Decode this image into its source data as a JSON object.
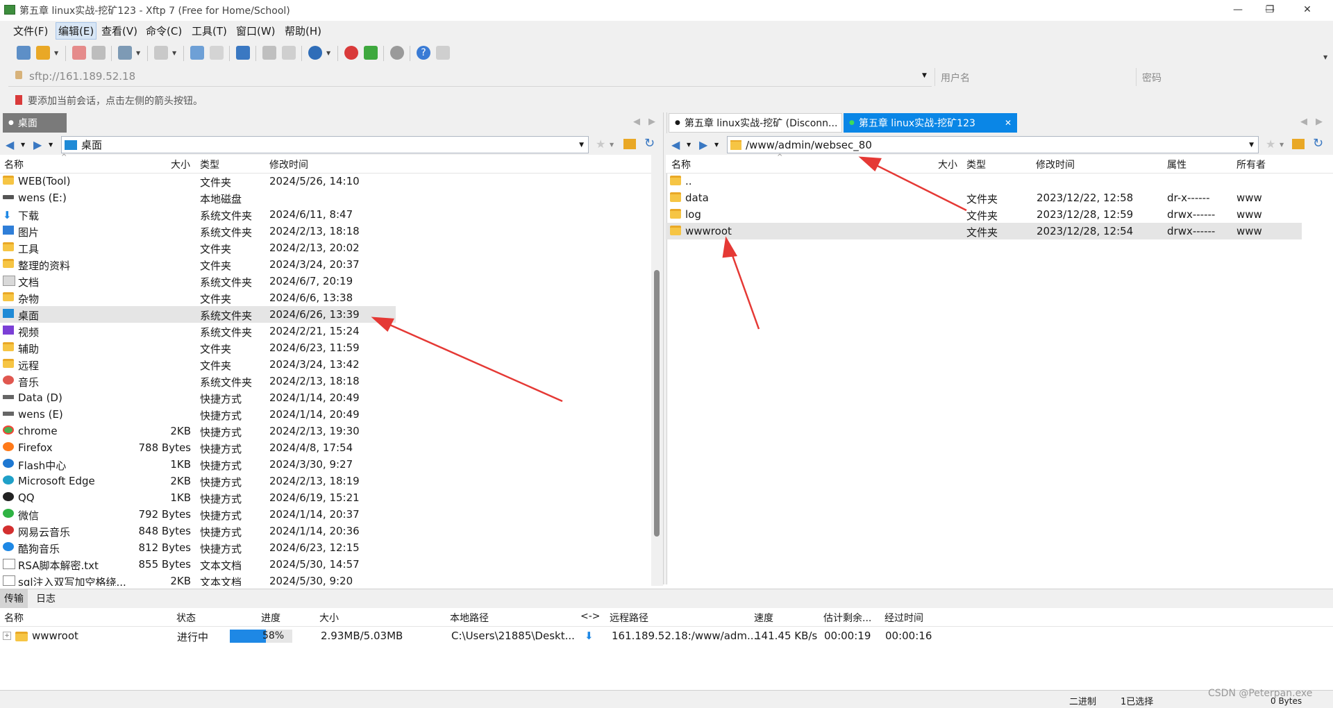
{
  "window": {
    "title": "第五章 linux实战-挖矿123 - Xftp 7 (Free for Home/School)",
    "minimize": "—",
    "maximize": "❐",
    "close": "✕"
  },
  "menu": [
    "文件(F)",
    "编辑(E)",
    "查看(V)",
    "命令(C)",
    "工具(T)",
    "窗口(W)",
    "帮助(H)"
  ],
  "address": {
    "value": "sftp://161.189.52.18",
    "user_placeholder": "用户名",
    "password_placeholder": "密码"
  },
  "hint": "要添加当前会话，点击左侧的箭头按钮。",
  "left_pane": {
    "tab": "桌面",
    "path": "桌面",
    "columns": [
      "名称",
      "大小",
      "类型",
      "修改时间"
    ],
    "rows": [
      {
        "name": "WEB(Tool)",
        "size": "",
        "type": "文件夹",
        "modified": "2024/5/26, 14:10",
        "icon": "folder-icon"
      },
      {
        "name": "wens (E:)",
        "size": "",
        "type": "本地磁盘",
        "modified": "",
        "icon": "drive-icon"
      },
      {
        "name": "下载",
        "size": "",
        "type": "系统文件夹",
        "modified": "2024/6/11, 8:47",
        "icon": "download-icon"
      },
      {
        "name": "图片",
        "size": "",
        "type": "系统文件夹",
        "modified": "2024/2/13, 18:18",
        "icon": "pictures-icon"
      },
      {
        "name": "工具",
        "size": "",
        "type": "文件夹",
        "modified": "2024/2/13, 20:02",
        "icon": "folder-icon"
      },
      {
        "name": "整理的资料",
        "size": "",
        "type": "文件夹",
        "modified": "2024/3/24, 20:37",
        "icon": "folder-icon"
      },
      {
        "name": "文档",
        "size": "",
        "type": "系统文件夹",
        "modified": "2024/6/7, 20:19",
        "icon": "documents-icon"
      },
      {
        "name": "杂物",
        "size": "",
        "type": "文件夹",
        "modified": "2024/6/6, 13:38",
        "icon": "folder-icon"
      },
      {
        "name": "桌面",
        "size": "",
        "type": "系统文件夹",
        "modified": "2024/6/26, 13:39",
        "icon": "desktop-icon",
        "selected": true
      },
      {
        "name": "视频",
        "size": "",
        "type": "系统文件夹",
        "modified": "2024/2/21, 15:24",
        "icon": "videos-icon"
      },
      {
        "name": "辅助",
        "size": "",
        "type": "文件夹",
        "modified": "2024/6/23, 11:59",
        "icon": "folder-icon"
      },
      {
        "name": "远程",
        "size": "",
        "type": "文件夹",
        "modified": "2024/3/24, 13:42",
        "icon": "folder-icon"
      },
      {
        "name": "音乐",
        "size": "",
        "type": "系统文件夹",
        "modified": "2024/2/13, 18:18",
        "icon": "music-icon"
      },
      {
        "name": "Data (D)",
        "size": "",
        "type": "快捷方式",
        "modified": "2024/1/14, 20:49",
        "icon": "drive-shortcut-icon"
      },
      {
        "name": "wens (E)",
        "size": "",
        "type": "快捷方式",
        "modified": "2024/1/14, 20:49",
        "icon": "drive-shortcut-icon"
      },
      {
        "name": "chrome",
        "size": "2KB",
        "type": "快捷方式",
        "modified": "2024/2/13, 19:30",
        "icon": "chrome-icon"
      },
      {
        "name": "Firefox",
        "size": "788 Bytes",
        "type": "快捷方式",
        "modified": "2024/4/8, 17:54",
        "icon": "firefox-icon"
      },
      {
        "name": "Flash中心",
        "size": "1KB",
        "type": "快捷方式",
        "modified": "2024/3/30, 9:27",
        "icon": "flash-icon"
      },
      {
        "name": "Microsoft Edge",
        "size": "2KB",
        "type": "快捷方式",
        "modified": "2024/2/13, 18:19",
        "icon": "edge-icon"
      },
      {
        "name": "QQ",
        "size": "1KB",
        "type": "快捷方式",
        "modified": "2024/6/19, 15:21",
        "icon": "qq-icon"
      },
      {
        "name": "微信",
        "size": "792 Bytes",
        "type": "快捷方式",
        "modified": "2024/1/14, 20:37",
        "icon": "wechat-icon"
      },
      {
        "name": "网易云音乐",
        "size": "848 Bytes",
        "type": "快捷方式",
        "modified": "2024/1/14, 20:36",
        "icon": "netease-music-icon"
      },
      {
        "name": "酷狗音乐",
        "size": "812 Bytes",
        "type": "快捷方式",
        "modified": "2024/6/23, 12:15",
        "icon": "kugou-icon"
      },
      {
        "name": "RSA脚本解密.txt",
        "size": "855 Bytes",
        "type": "文本文档",
        "modified": "2024/5/30, 14:57",
        "icon": "text-file-icon"
      },
      {
        "name": "sql注入双写加空格绕...",
        "size": "2KB",
        "type": "文本文档",
        "modified": "2024/5/30, 9:20",
        "icon": "text-file-icon"
      }
    ]
  },
  "right_pane": {
    "tabs": [
      {
        "label": "第五章 linux实战-挖矿 (Disconn...",
        "active": false,
        "dot": "●"
      },
      {
        "label": "第五章 linux实战-挖矿123",
        "active": true,
        "dot": "●",
        "close": "✕"
      }
    ],
    "path": "/www/admin/websec_80",
    "columns": [
      "名称",
      "大小",
      "类型",
      "修改时间",
      "属性",
      "所有者"
    ],
    "rows": [
      {
        "name": "..",
        "size": "",
        "type": "",
        "modified": "",
        "attr": "",
        "owner": ""
      },
      {
        "name": "data",
        "size": "",
        "type": "文件夹",
        "modified": "2023/12/22, 12:58",
        "attr": "dr-x------",
        "owner": "www"
      },
      {
        "name": "log",
        "size": "",
        "type": "文件夹",
        "modified": "2023/12/28, 12:59",
        "attr": "drwx------",
        "owner": "www"
      },
      {
        "name": "wwwroot",
        "size": "",
        "type": "文件夹",
        "modified": "2023/12/28, 12:54",
        "attr": "drwx------",
        "owner": "www",
        "selected": true
      }
    ]
  },
  "bottom": {
    "tabs": [
      "传输",
      "日志"
    ],
    "columns": [
      "名称",
      "状态",
      "进度",
      "大小",
      "本地路径",
      "<->",
      "远程路径",
      "速度",
      "估计剩余...",
      "经过时间"
    ],
    "transfer": {
      "expander": "+",
      "name": "wwwroot",
      "status": "进行中",
      "progress_label": "58%",
      "progress": 0.58,
      "size": "2.93MB/5.03MB",
      "local_path": "C:\\Users\\21885\\Deskt...",
      "direction": "⬇",
      "remote_path": "161.189.52.18:/www/adm...",
      "speed": "141.45 KB/s",
      "remaining": "00:00:19",
      "elapsed": "00:00:16"
    }
  },
  "status": {
    "mode": "二进制",
    "selection": "1已选择",
    "bytes": "0 Bytes",
    "watermark": "CSDN @Peterpan.exe"
  },
  "colors": {
    "accent": "#0078d7",
    "selected_row": "#e5e5e5",
    "arrow": "#e53935",
    "folder": "#f6c544"
  }
}
